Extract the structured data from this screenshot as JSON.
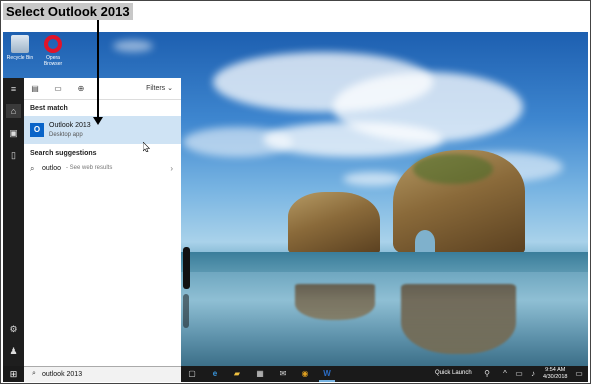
{
  "annotation": {
    "callout": "Select Outlook 2013"
  },
  "desktop_icons": [
    {
      "label": "Recycle Bin",
      "name": "recycle-bin-icon"
    },
    {
      "label": "Opera Browser",
      "name": "opera-icon"
    }
  ],
  "start_menu": {
    "rail_icons": [
      "hamburger-icon",
      "home-icon",
      "documents-icon",
      "phone-icon",
      "settings-icon",
      "person-icon"
    ],
    "toolbar_icons": [
      "apps-icon",
      "document-icon",
      "globe-icon"
    ],
    "filters_label": "Filters",
    "best_match_heading": "Best match",
    "best_match": {
      "title": "Outlook 2013",
      "subtitle": "Desktop app"
    },
    "suggestions_heading": "Search suggestions",
    "suggestion": {
      "query": "outloo",
      "hint": " - See web results"
    }
  },
  "taskbar": {
    "search_value": "outlook 2013",
    "quick_launch": "Quick Launch",
    "time": "9:54 AM",
    "date": "4/30/2018",
    "accent_color": "#78b4e2"
  }
}
